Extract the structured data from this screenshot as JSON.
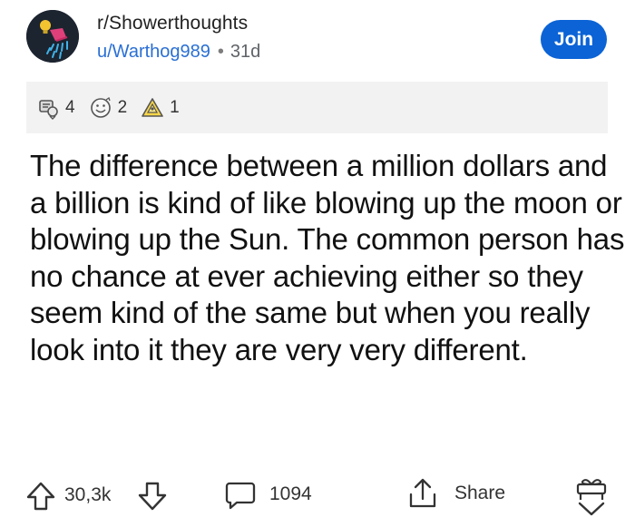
{
  "post": {
    "subreddit": "r/Showerthoughts",
    "username": "u/Warthog989",
    "separator": "•",
    "age": "31d",
    "join_label": "Join",
    "awards": [
      {
        "icon": "silver-award-icon",
        "count": "4"
      },
      {
        "icon": "helpful-award-icon",
        "count": "2"
      },
      {
        "icon": "wholesome-award-icon",
        "count": "1"
      }
    ],
    "body": "The difference between a million dollars and a billion is kind of like blowing up the moon or blowing up the Sun. The common person has no chance at ever achieving either so they seem kind of the same but when you really look into it they are very very different."
  },
  "actions": {
    "score": "30,3k",
    "comments": "1094",
    "share": "Share"
  },
  "colors": {
    "join_bg": "#0b63d6",
    "username": "#2a6fd4",
    "award_bar": "#f2f2f2",
    "avatar_bg": "#1c2430"
  }
}
